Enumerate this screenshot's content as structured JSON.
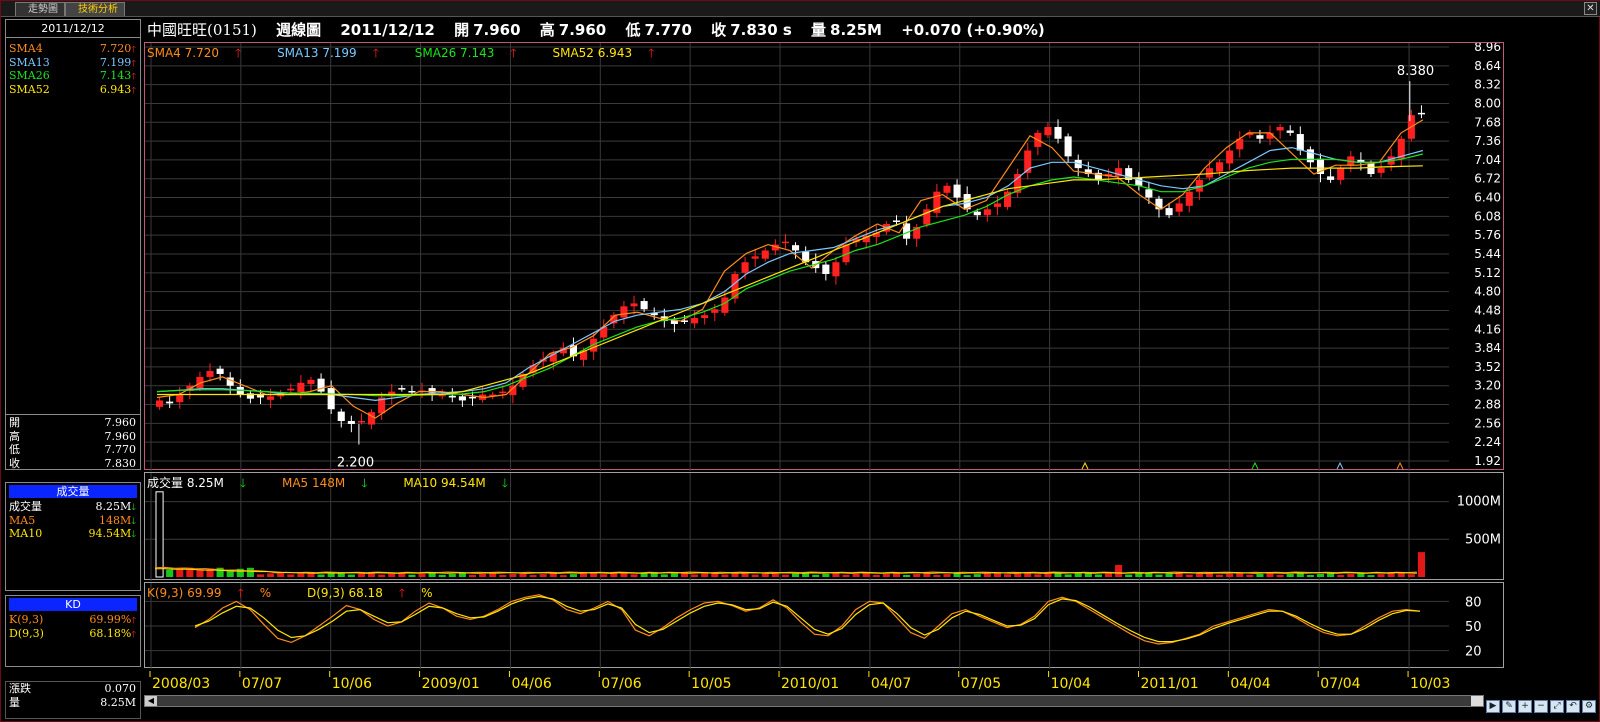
{
  "tabs": [
    {
      "label": "走勢圖",
      "active": false
    },
    {
      "label": "技術分析",
      "active": true
    }
  ],
  "side": {
    "date": "2011/12/12",
    "sma": [
      {
        "name": "SMA4",
        "value": "7.720",
        "color": "#ff8c1a",
        "dir": "up"
      },
      {
        "name": "SMA13",
        "value": "7.199",
        "color": "#7ac9ff",
        "dir": "up"
      },
      {
        "name": "SMA26",
        "value": "7.143",
        "color": "#19e619",
        "dir": "up"
      },
      {
        "name": "SMA52",
        "value": "6.943",
        "color": "#ffe600",
        "dir": "up"
      }
    ],
    "ohlc": [
      {
        "name": "開",
        "value": "7.960"
      },
      {
        "name": "高",
        "value": "7.960"
      },
      {
        "name": "低",
        "value": "7.770"
      },
      {
        "name": "收",
        "value": "7.830"
      }
    ],
    "vol_header": "成交量",
    "vol": [
      {
        "name": "成交量",
        "value": "8.25M",
        "color": "#ffffff",
        "dir": "down"
      },
      {
        "name": "MA5",
        "value": "148M",
        "color": "#ff8c1a",
        "dir": "down"
      },
      {
        "name": "MA10",
        "value": "94.54M",
        "color": "#ffe600",
        "dir": "down"
      }
    ],
    "kd_header": "KD",
    "kd": [
      {
        "name": "K(9,3)",
        "value": "69.99%",
        "color": "#ff8c1a",
        "dir": "up"
      },
      {
        "name": "D(9,3)",
        "value": "68.18%",
        "color": "#ffe600",
        "dir": "up"
      }
    ],
    "bottom": [
      {
        "name": "漲跌",
        "value": "0.070"
      },
      {
        "name": "量",
        "value": "8.25M"
      }
    ]
  },
  "header": {
    "name": "中國旺旺(0151)",
    "period": "週線圖",
    "date": "2011/12/12",
    "open_label": "開",
    "open": "7.960",
    "high_label": "高",
    "high": "7.960",
    "low_label": "低",
    "low": "7.770",
    "close_label": "收",
    "close": "7.830 s",
    "vol_label": "量",
    "vol": "8.25M",
    "change": "+0.070 (+0.90%)"
  },
  "price_legend": [
    {
      "text": "SMA4 7.720",
      "color": "#ff8c1a"
    },
    {
      "text": "SMA13 7.199",
      "color": "#7ac9ff"
    },
    {
      "text": "SMA26 7.143",
      "color": "#19e619"
    },
    {
      "text": "SMA52 6.943",
      "color": "#ffe600"
    }
  ],
  "vol_legend": [
    {
      "text": "成交量 8.25M",
      "color": "#ffffff",
      "dir": "down"
    },
    {
      "text": "MA5 148M",
      "color": "#ff8c1a",
      "dir": "down"
    },
    {
      "text": "MA10 94.54M",
      "color": "#ffe600",
      "dir": "down"
    }
  ],
  "kd_legend": [
    {
      "text": "K(9,3) 69.99",
      "suffix": "%",
      "color": "#ff8c1a"
    },
    {
      "text": "D(9,3) 68.18",
      "suffix": "%",
      "color": "#ffe600"
    }
  ],
  "annotations": {
    "high": "8.380",
    "low": "2.200"
  },
  "chart_data": [
    {
      "type": "line",
      "name": "price",
      "y_ticks": [
        "8.96",
        "8.64",
        "8.32",
        "8.00",
        "7.68",
        "7.36",
        "7.04",
        "6.72",
        "6.40",
        "6.08",
        "5.76",
        "5.44",
        "5.12",
        "4.80",
        "4.48",
        "4.16",
        "3.84",
        "3.52",
        "3.20",
        "2.88",
        "2.56",
        "2.24",
        "1.92"
      ],
      "ylim": [
        1.92,
        8.96
      ],
      "x_ticks": [
        "2008/03",
        "07/07",
        "10/06",
        "2009/01",
        "04/06",
        "07/06",
        "10/05",
        "2010/01",
        "04/07",
        "07/05",
        "10/04",
        "2011/01",
        "04/04",
        "07/04",
        "10/03"
      ],
      "close": [
        2.95,
        2.9,
        3.05,
        3.2,
        3.35,
        3.45,
        3.4,
        3.2,
        3.05,
        2.98,
        3.0,
        3.02,
        3.08,
        3.15,
        3.25,
        3.3,
        3.1,
        2.8,
        2.6,
        2.55,
        2.6,
        2.75,
        3.0,
        3.1,
        3.15,
        3.1,
        3.12,
        3.08,
        3.05,
        3.0,
        2.95,
        3.0,
        3.05,
        3.05,
        3.1,
        3.2,
        3.4,
        3.55,
        3.65,
        3.75,
        3.85,
        3.7,
        3.8,
        4.0,
        4.2,
        4.4,
        4.55,
        4.6,
        4.5,
        4.4,
        4.3,
        4.25,
        4.3,
        4.35,
        4.4,
        4.5,
        4.7,
        5.1,
        5.3,
        5.4,
        5.5,
        5.6,
        5.65,
        5.5,
        5.3,
        5.2,
        5.1,
        5.3,
        5.6,
        5.7,
        5.75,
        5.8,
        5.95,
        6.0,
        5.7,
        5.9,
        6.2,
        6.5,
        6.6,
        6.4,
        6.2,
        6.1,
        6.2,
        6.3,
        6.5,
        6.8,
        7.2,
        7.5,
        7.6,
        7.4,
        7.1,
        6.9,
        6.8,
        6.7,
        6.8,
        6.9,
        6.7,
        6.6,
        6.4,
        6.2,
        6.1,
        6.3,
        6.5,
        6.7,
        6.9,
        7.0,
        7.2,
        7.4,
        7.5,
        7.4,
        7.5,
        7.6,
        7.5,
        7.2,
        7.0,
        6.8,
        6.7,
        6.9,
        7.1,
        7.0,
        6.8,
        6.9,
        7.1,
        7.4,
        7.8,
        7.83
      ],
      "high_point": 8.38,
      "low_point": 2.2,
      "sma": [
        {
          "name": "SMA4",
          "values": [
            3.0,
            3.05,
            3.25,
            3.35,
            3.2,
            3.05,
            3.05,
            3.1,
            3.2,
            2.85,
            2.65,
            2.9,
            3.1,
            3.1,
            3.05,
            3.0,
            3.05,
            3.4,
            3.75,
            3.85,
            4.05,
            4.4,
            4.45,
            4.35,
            4.3,
            4.5,
            5.15,
            5.45,
            5.6,
            5.5,
            5.2,
            5.5,
            5.75,
            5.95,
            5.8,
            6.35,
            6.45,
            6.2,
            6.35,
            6.9,
            7.45,
            7.25,
            6.85,
            6.8,
            6.75,
            6.45,
            6.2,
            6.45,
            6.9,
            7.25,
            7.5,
            7.5,
            7.15,
            6.8,
            6.95,
            6.95,
            7.0,
            7.5,
            7.72
          ]
        },
        {
          "name": "SMA13",
          "values": [
            3.1,
            3.12,
            3.15,
            3.15,
            3.12,
            3.1,
            3.05,
            3.05,
            3.05,
            3.0,
            2.95,
            3.0,
            3.05,
            3.08,
            3.1,
            3.15,
            3.25,
            3.5,
            3.7,
            3.9,
            4.1,
            4.3,
            4.4,
            4.45,
            4.5,
            4.6,
            4.8,
            5.1,
            5.3,
            5.45,
            5.5,
            5.55,
            5.7,
            5.85,
            5.95,
            6.1,
            6.25,
            6.3,
            6.4,
            6.6,
            6.9,
            7.0,
            7.0,
            6.9,
            6.8,
            6.7,
            6.6,
            6.55,
            6.6,
            6.8,
            7.0,
            7.2,
            7.25,
            7.15,
            7.05,
            7.0,
            7.0,
            7.1,
            7.2
          ]
        },
        {
          "name": "SMA26",
          "values": [
            3.1,
            3.12,
            3.13,
            3.13,
            3.12,
            3.1,
            3.08,
            3.07,
            3.06,
            3.05,
            3.03,
            3.03,
            3.04,
            3.05,
            3.06,
            3.1,
            3.2,
            3.35,
            3.5,
            3.7,
            3.9,
            4.05,
            4.2,
            4.3,
            4.35,
            4.45,
            4.6,
            4.85,
            5.0,
            5.15,
            5.25,
            5.35,
            5.5,
            5.6,
            5.75,
            5.9,
            6.0,
            6.1,
            6.25,
            6.45,
            6.6,
            6.7,
            6.75,
            6.7,
            6.65,
            6.6,
            6.5,
            6.5,
            6.6,
            6.75,
            6.9,
            7.0,
            7.05,
            7.05,
            7.05,
            7.0,
            7.0,
            7.05,
            7.14
          ]
        },
        {
          "name": "SMA52",
          "values": [
            3.05,
            3.05,
            3.05,
            3.05,
            3.05,
            3.05,
            3.05,
            3.05,
            3.05,
            3.05,
            3.05,
            3.05,
            3.05,
            3.05,
            3.1,
            3.2,
            3.3,
            3.4,
            3.55,
            3.7,
            3.85,
            4.0,
            4.15,
            4.3,
            4.45,
            4.6,
            4.75,
            4.9,
            5.05,
            5.2,
            5.35,
            5.5,
            5.65,
            5.8,
            5.95,
            6.1,
            6.25,
            6.35,
            6.45,
            6.55,
            6.6,
            6.65,
            6.7,
            6.7,
            6.72,
            6.74,
            6.76,
            6.78,
            6.8,
            6.83,
            6.86,
            6.88,
            6.9,
            6.9,
            6.9,
            6.9,
            6.92,
            6.93,
            6.94
          ]
        }
      ]
    },
    {
      "type": "bar",
      "name": "volume",
      "y_ticks": [
        "1000M",
        "500M"
      ],
      "ylim": [
        0,
        1300
      ],
      "unit": "M",
      "first_bar": 1130,
      "last_bar": 330
    },
    {
      "type": "line",
      "name": "kd",
      "y_ticks": [
        "80",
        "50",
        "20"
      ],
      "ylim": [
        0,
        100
      ],
      "k": [
        48,
        58,
        72,
        80,
        70,
        52,
        35,
        30,
        38,
        50,
        62,
        75,
        70,
        58,
        50,
        55,
        68,
        78,
        72,
        62,
        58,
        62,
        70,
        80,
        85,
        88,
        82,
        70,
        65,
        72,
        80,
        70,
        45,
        38,
        48,
        60,
        70,
        78,
        80,
        75,
        68,
        72,
        82,
        72,
        55,
        40,
        38,
        50,
        70,
        80,
        78,
        60,
        42,
        35,
        50,
        65,
        70,
        62,
        55,
        48,
        52,
        62,
        80,
        85,
        80,
        70,
        60,
        50,
        40,
        32,
        28,
        30,
        35,
        40,
        50,
        55,
        60,
        65,
        70,
        68,
        60,
        50,
        42,
        38,
        40,
        50,
        60,
        68,
        70,
        68
      ],
      "d": [
        50,
        56,
        66,
        74,
        72,
        60,
        45,
        36,
        38,
        46,
        56,
        68,
        70,
        62,
        54,
        55,
        64,
        74,
        72,
        65,
        60,
        61,
        68,
        77,
        83,
        86,
        83,
        74,
        68,
        70,
        77,
        72,
        52,
        42,
        46,
        56,
        66,
        74,
        78,
        76,
        70,
        71,
        79,
        74,
        60,
        46,
        40,
        47,
        64,
        76,
        78,
        65,
        48,
        39,
        46,
        60,
        68,
        64,
        57,
        50,
        51,
        59,
        76,
        83,
        81,
        73,
        63,
        53,
        44,
        36,
        31,
        31,
        34,
        39,
        47,
        53,
        58,
        63,
        68,
        68,
        62,
        53,
        45,
        40,
        40,
        47,
        57,
        65,
        69,
        68
      ]
    }
  ]
}
